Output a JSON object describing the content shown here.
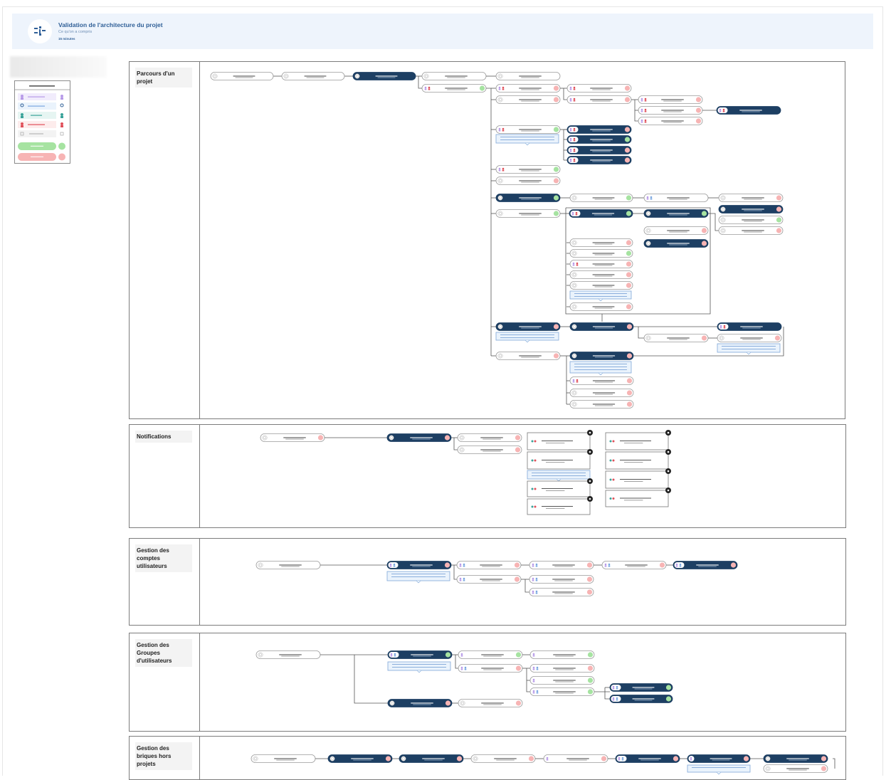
{
  "header": {
    "title": "Validation de l'architecture du projet",
    "subtitle": "Ce qu'on a compris",
    "duration": "15 minutes"
  },
  "sections": [
    {
      "key": "parcours",
      "title": "Parcours d'un projet"
    },
    {
      "key": "notifications",
      "title": "Notifications"
    },
    {
      "key": "comptes",
      "title": "Gestion des comptes utilisateurs"
    },
    {
      "key": "groupes",
      "title": "Gestion des Groupes d'utilisateurs"
    },
    {
      "key": "briques",
      "title": "Gestion des briques hors projets"
    }
  ],
  "colors": {
    "dark_node": "#1d3f63",
    "light_node_border": "#9a9a9a",
    "status_green": "#a6e3a1",
    "status_red": "#f7b4b4",
    "note_fill": "#eaf3fc",
    "note_border": "#7fa7d8",
    "header_bg": "#eef4fc",
    "title_color": "#2f5f97",
    "legend_purple": "#b79ae8",
    "legend_blue": "#7aa7e0",
    "legend_teal": "#3aa39a",
    "legend_red": "#e0505a"
  },
  "icons": [
    "diagram-logo-icon",
    "user-icon",
    "document-icon",
    "status-dot-icon"
  ]
}
